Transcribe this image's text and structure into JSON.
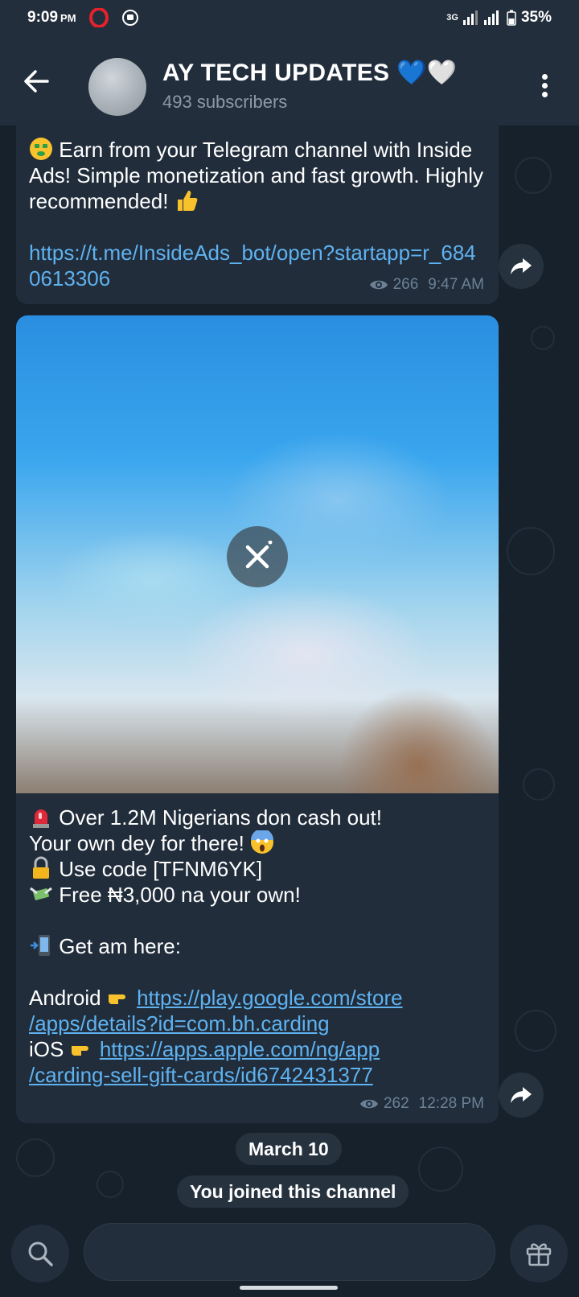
{
  "status_bar": {
    "time": "9:09",
    "ampm": "PM",
    "network": "3G",
    "battery": "35%"
  },
  "header": {
    "title": "AY TECH UPDATES 💙🤍",
    "subscribers": "493 subscribers"
  },
  "messages": [
    {
      "text": "Earn from your Telegram channel with Inside Ads! Simple monetization and fast growth. Highly recommended!",
      "link": "https://t.me/InsideAds_bot/open?startapp=r_6840613306",
      "views": "266",
      "time": "9:47 AM"
    },
    {
      "line1": "Over 1.2M Nigerians don cash out!",
      "line2": "Your own dey for there!",
      "line3": "Use code [TFNM6YK]",
      "line4": "Free ₦3,000 na your own!",
      "line5": "Get am here:",
      "android_label": "Android",
      "android_link_1": "https://play.google.com/store",
      "android_link_2": "/apps/details?id=com.bh.carding",
      "ios_label": "iOS",
      "ios_link_1": "https://apps.apple.com/ng/app",
      "ios_link_2": "/carding-sell-gift-cards/id6742431377",
      "views": "262",
      "time": "12:28 PM"
    }
  ],
  "service": {
    "date": "March 10",
    "joined": "You joined this channel"
  },
  "input": {
    "placeholder": ""
  },
  "icons": {
    "back": "arrow-left-icon",
    "menu": "more-vertical-icon",
    "share": "share-arrow-icon",
    "views": "eye-icon",
    "cancel": "close-icon",
    "search": "search-icon",
    "gift": "gift-icon"
  },
  "colors": {
    "header_bg": "#232e3c",
    "chat_bg": "#17212b",
    "bubble_bg": "#212d3b",
    "link": "#5fb2f0",
    "meta": "#6d8196"
  }
}
